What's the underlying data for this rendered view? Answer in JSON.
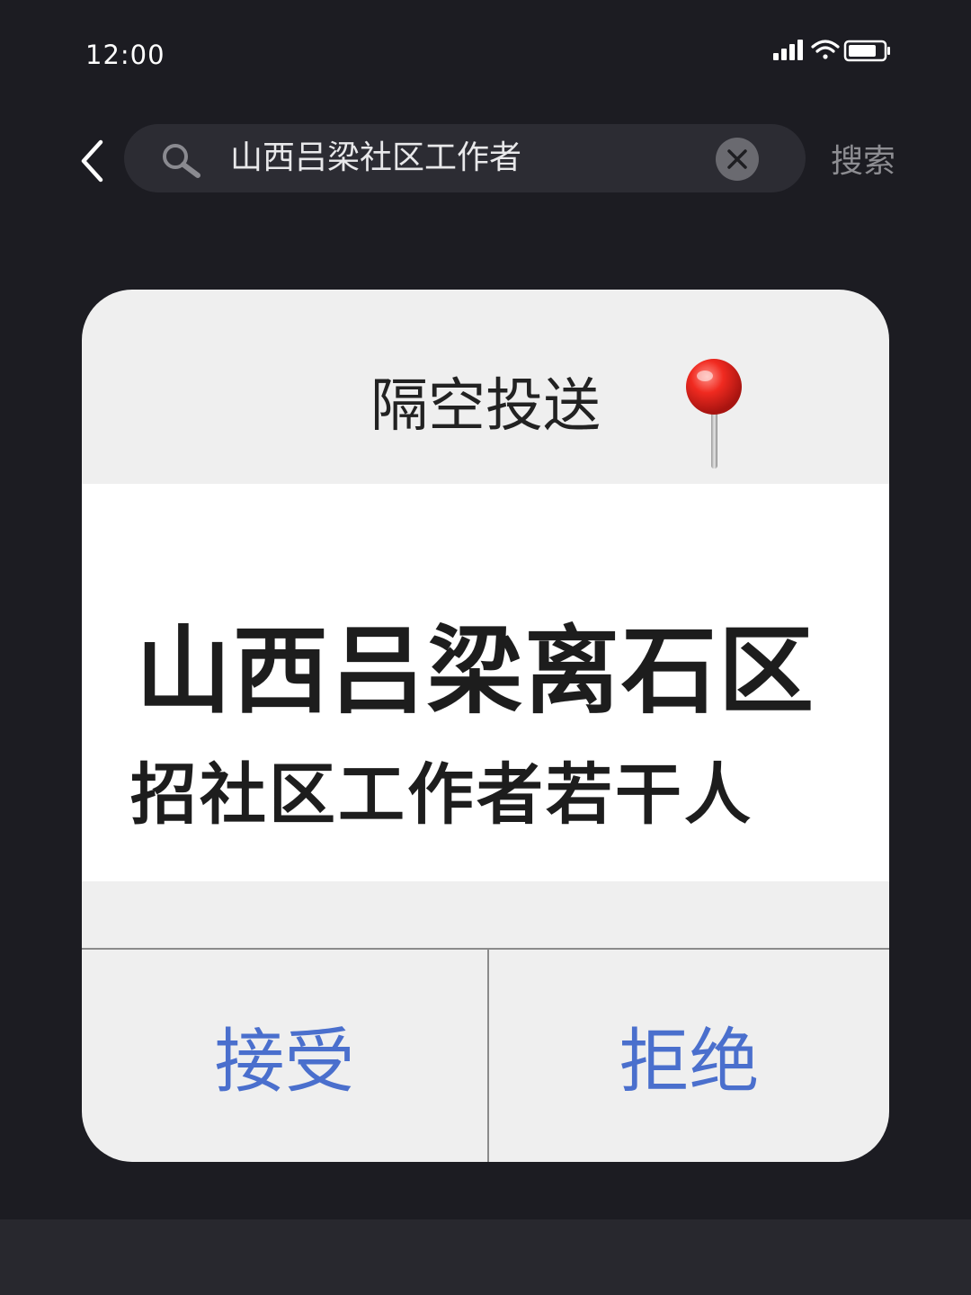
{
  "status_bar": {
    "time": "12:00"
  },
  "search": {
    "query": "山西吕梁社区工作者",
    "button_label": "搜索"
  },
  "dialog": {
    "title": "隔空投送",
    "headline_line1": "山西吕梁离石区",
    "headline_line2": "招社区工作者若干人",
    "accept_label": "接受",
    "reject_label": "拒绝"
  },
  "colors": {
    "background": "#1c1c22",
    "search_box": "#2c2c33",
    "accent": "#4a6fcd",
    "pin": "#e3231e"
  }
}
